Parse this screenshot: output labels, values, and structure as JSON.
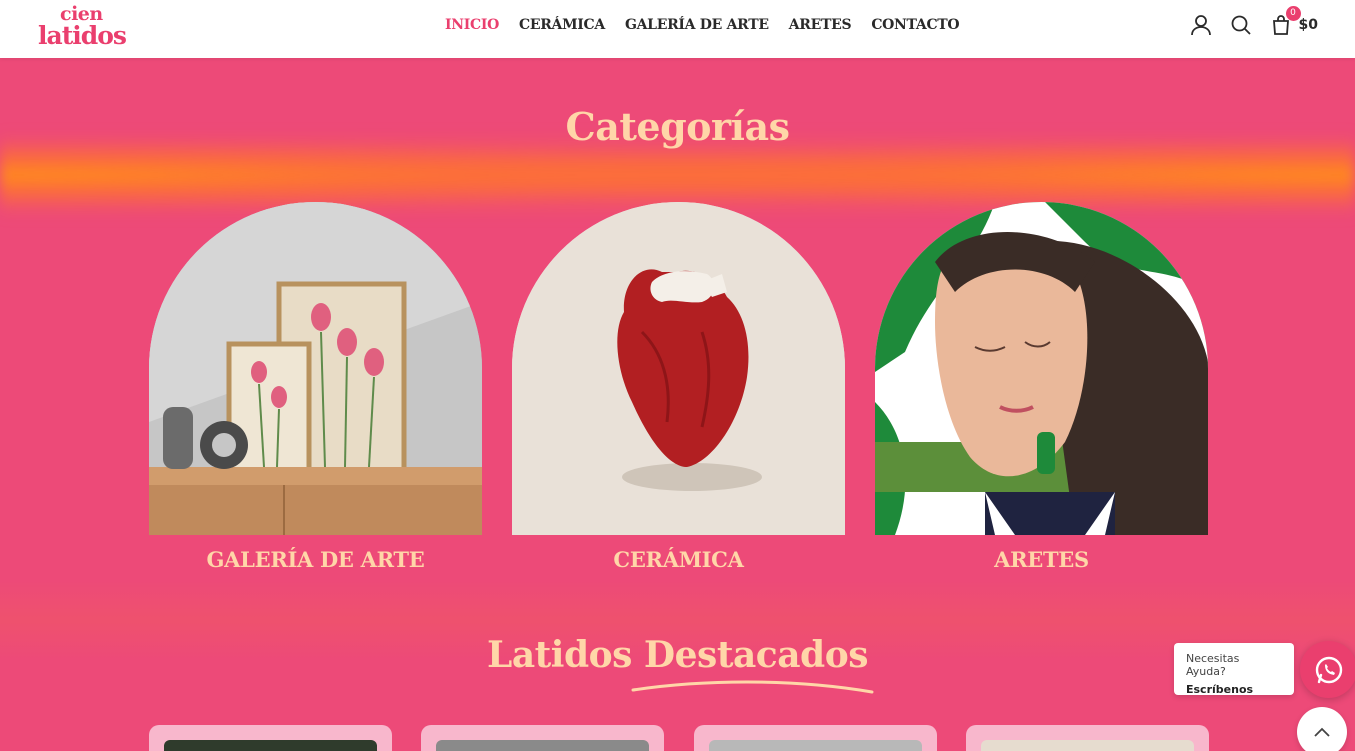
{
  "brand": {
    "logo_line1": "cien",
    "logo_line2": "latidos",
    "accent_color": "#ea3f6e",
    "bg_color": "#ed4a78",
    "title_color": "#ffd6a8"
  },
  "nav": {
    "items": [
      {
        "label": "INICIO",
        "active": true
      },
      {
        "label": "CERÁMICA",
        "active": false
      },
      {
        "label": "GALERÍA DE ARTE",
        "active": false
      },
      {
        "label": "ARETES",
        "active": false
      },
      {
        "label": "CONTACTO",
        "active": false
      }
    ]
  },
  "header": {
    "account_icon": "user-icon",
    "search_icon": "search-icon",
    "cart_icon": "shopping-bag-icon",
    "cart_count": "0",
    "cart_total": "$0"
  },
  "categories": {
    "title": "Categorías",
    "items": [
      {
        "label": "GALERÍA DE ARTE",
        "image": "framed-tulip-prints"
      },
      {
        "label": "CERÁMICA",
        "image": "red-ceramic-heart"
      },
      {
        "label": "ARETES",
        "image": "woman-with-green-earrings"
      }
    ]
  },
  "featured": {
    "title": "Latidos Destacados"
  },
  "whatsapp": {
    "question": "Necesitas Ayuda?",
    "cta": "Escríbenos",
    "icon": "whatsapp-icon"
  },
  "scroll_top": {
    "icon": "chevron-up-icon"
  }
}
